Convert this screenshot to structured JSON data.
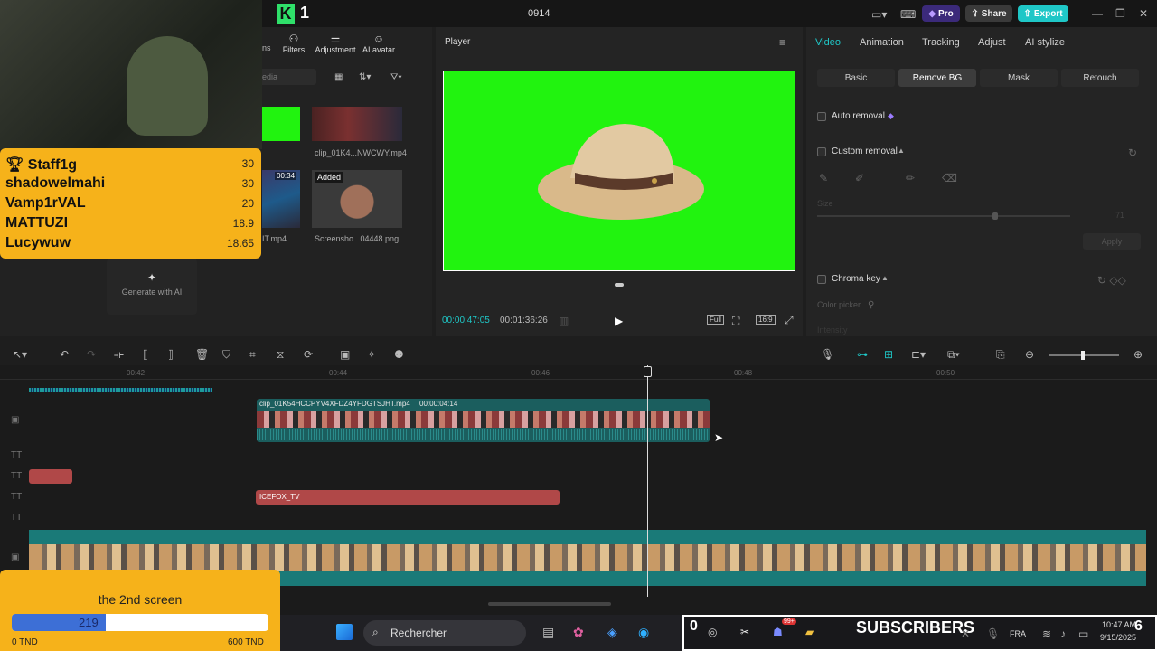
{
  "titlebar": {
    "logo": "K",
    "logo_num": "1",
    "project": "0914",
    "pro": "Pro",
    "share": "Share",
    "export": "Export"
  },
  "media": {
    "tabs": [
      "ns",
      "Filters",
      "Adjustment",
      "AI avatar"
    ],
    "search_placeholder": "edia",
    "items": [
      {
        "name": "clip_01K4...NWCWY.mp4"
      },
      {
        "duration": "00:34",
        "name": "IT.mp4"
      },
      {
        "badge": "Added",
        "name": "Screensho...04448.png"
      }
    ],
    "generate": "Generate with AI"
  },
  "player": {
    "title": "Player",
    "current": "00:00:47:05",
    "total": "00:01:36:26",
    "full": "Full",
    "ratio": "16:9"
  },
  "props": {
    "tabs": [
      "Video",
      "Animation",
      "Tracking",
      "Adjust",
      "AI stylize"
    ],
    "subtabs": [
      "Basic",
      "Remove BG",
      "Mask",
      "Retouch"
    ],
    "auto_removal": "Auto removal",
    "custom_removal": "Custom removal",
    "size_label": "Size",
    "size_value": "71",
    "apply": "Apply",
    "chroma": "Chroma key",
    "color_picker": "Color picker",
    "intensity": "Intensity"
  },
  "timeline": {
    "ruler": [
      "00:42",
      "00:44",
      "00:46",
      "00:48",
      "00:50"
    ],
    "clip_label": "clip_01K54HCCPYV4XFDZ4YFDGTSJHT.mp4",
    "clip_duration": "00:00:04:14",
    "text_clip": "ICEFOX_TV"
  },
  "overlay": {
    "leaderboard": [
      {
        "name": "Staff1g",
        "value": "30"
      },
      {
        "name": "shadowelmahi",
        "value": "30"
      },
      {
        "name": "Vamp1rVAL",
        "value": "20"
      },
      {
        "name": "MATTUZI",
        "value": "18.9"
      },
      {
        "name": "Lucywuw",
        "value": "18.65"
      }
    ],
    "goal_title": "the 2nd screen",
    "goal_current": "219",
    "goal_progress": 0.365,
    "goal_min": "0 TND",
    "goal_max": "600 TND",
    "subs_count": "0",
    "subs_label": "SUBSCRIBERS",
    "subs_badge": "6"
  },
  "taskbar": {
    "search": "Rechercher",
    "lang": "FRA",
    "time": "10:47 AM",
    "date": "9/15/2025",
    "notif": "99+"
  },
  "colors": {
    "accent": "#1fc7c7",
    "green_screen": "#21f30f",
    "overlay": "#f6b21a",
    "export": "#1fc7c7",
    "pro": "#5b3fd6"
  }
}
